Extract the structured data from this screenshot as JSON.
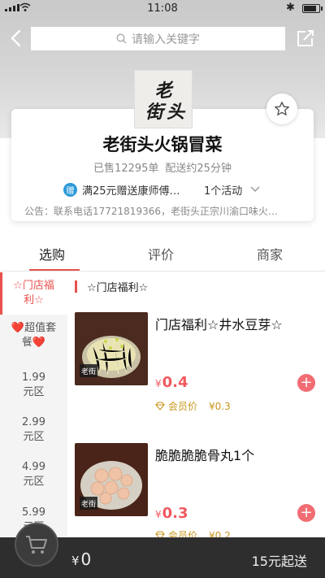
{
  "status_bar": {
    "time": "11:08"
  },
  "search": {
    "placeholder": "请输入关键字"
  },
  "logo": {
    "text": "老街头"
  },
  "shop": {
    "name": "老街头火锅冒菜",
    "sold": "已售12295单",
    "delivery": "配送约25分钟",
    "promo_badge": "赠",
    "promo_text": "满25元赠送康师傅…",
    "promo_count": "1个活动",
    "notice": "公告：联系电话17721819366，老街头正宗川渝口味火…"
  },
  "tabs": [
    {
      "label": "选购"
    },
    {
      "label": "评价"
    },
    {
      "label": "商家"
    }
  ],
  "categories": [
    {
      "line1": "☆门店福",
      "line2": "利☆"
    },
    {
      "line1": "❤️超值套",
      "line2": "餐❤️"
    },
    {
      "line1": "1.99",
      "line2": "元区"
    },
    {
      "line1": "2.99",
      "line2": "元区"
    },
    {
      "line1": "4.99",
      "line2": "元区"
    },
    {
      "line1": "5.99",
      "line2": "元区"
    }
  ],
  "section": {
    "title": "☆门店福利☆"
  },
  "items": [
    {
      "name": "门店福利☆井水豆芽☆",
      "currency": "¥",
      "price": "0.4",
      "vip_label": "会员价",
      "vip_price": "¥0.3"
    },
    {
      "name": "脆脆脆脆骨丸1个",
      "currency": "¥",
      "price": "0.3",
      "vip_label": "会员价",
      "vip_price": "¥0.2"
    }
  ],
  "cart": {
    "currency": "¥",
    "total": "0",
    "min_order": "15元起送"
  },
  "colors": {
    "accent": "#e8514d",
    "price": "#f05a5f",
    "badge": "#2d9ad9",
    "vip": "#c8961e",
    "bottom_bar": "#2e2e2e"
  }
}
